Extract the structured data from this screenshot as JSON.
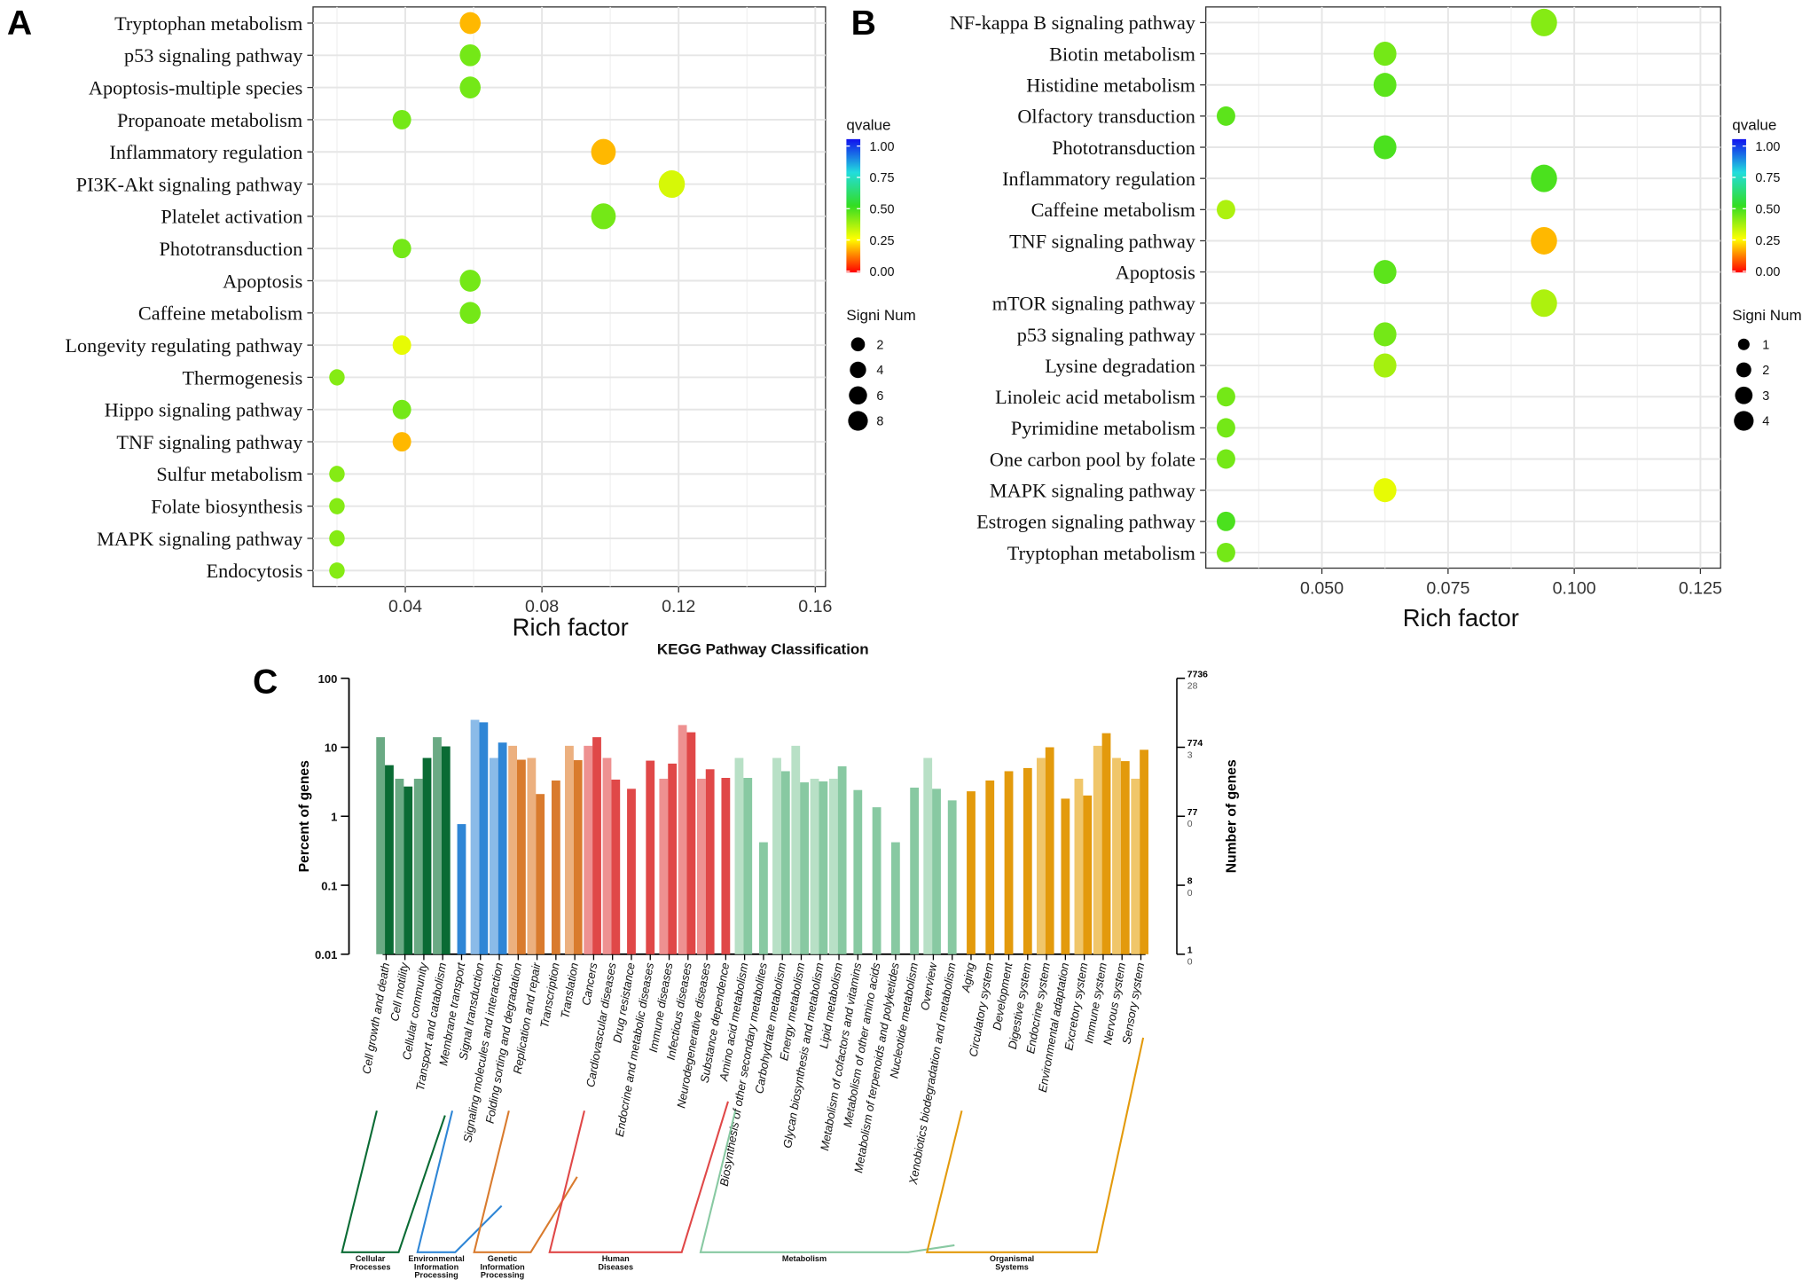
{
  "panels": {
    "a": "A",
    "b": "B",
    "c": "C"
  },
  "chart_data": [
    {
      "id": "panel-a",
      "type": "scatter",
      "title": "",
      "xlabel": "Rich factor",
      "ylabel": "",
      "xlim": [
        0.013,
        0.163
      ],
      "xticks": [
        0.04,
        0.08,
        0.12,
        0.16
      ],
      "xtick_labels": [
        "0.04",
        "0.08",
        "0.12",
        "0.16"
      ],
      "grid": true,
      "legend": {
        "placement": "right",
        "color_title": "qvalue",
        "color_ticks": [
          "1.00",
          "0.75",
          "0.50",
          "0.25",
          "0.00"
        ],
        "size_title": "Signi Num",
        "size_values": [
          2,
          4,
          6,
          8
        ]
      },
      "points": [
        {
          "pathway": "Tryptophan metabolism",
          "rich_factor": 0.059,
          "qvalue": 0.18,
          "signi_num": 3
        },
        {
          "pathway": "p53 signaling pathway",
          "rich_factor": 0.059,
          "qvalue": 0.42,
          "signi_num": 3
        },
        {
          "pathway": "Apoptosis-multiple species",
          "rich_factor": 0.059,
          "qvalue": 0.42,
          "signi_num": 3
        },
        {
          "pathway": "Propanoate metabolism",
          "rich_factor": 0.039,
          "qvalue": 0.42,
          "signi_num": 2
        },
        {
          "pathway": "Inflammatory regulation",
          "rich_factor": 0.098,
          "qvalue": 0.18,
          "signi_num": 5
        },
        {
          "pathway": "PI3K-Akt signaling pathway",
          "rich_factor": 0.118,
          "qvalue": 0.3,
          "signi_num": 6
        },
        {
          "pathway": "Platelet activation",
          "rich_factor": 0.098,
          "qvalue": 0.42,
          "signi_num": 5
        },
        {
          "pathway": "Phototransduction",
          "rich_factor": 0.039,
          "qvalue": 0.42,
          "signi_num": 2
        },
        {
          "pathway": "Apoptosis",
          "rich_factor": 0.059,
          "qvalue": 0.42,
          "signi_num": 3
        },
        {
          "pathway": "Caffeine metabolism",
          "rich_factor": 0.059,
          "qvalue": 0.42,
          "signi_num": 3
        },
        {
          "pathway": "Longevity regulating pathway",
          "rich_factor": 0.039,
          "qvalue": 0.28,
          "signi_num": 2
        },
        {
          "pathway": "Thermogenesis",
          "rich_factor": 0.02,
          "qvalue": 0.4,
          "signi_num": 1
        },
        {
          "pathway": "Hippo signaling pathway",
          "rich_factor": 0.039,
          "qvalue": 0.42,
          "signi_num": 2
        },
        {
          "pathway": "TNF signaling pathway",
          "rich_factor": 0.039,
          "qvalue": 0.18,
          "signi_num": 2
        },
        {
          "pathway": "Sulfur metabolism",
          "rich_factor": 0.02,
          "qvalue": 0.4,
          "signi_num": 1
        },
        {
          "pathway": "Folate biosynthesis",
          "rich_factor": 0.02,
          "qvalue": 0.4,
          "signi_num": 1
        },
        {
          "pathway": "MAPK signaling pathway",
          "rich_factor": 0.02,
          "qvalue": 0.4,
          "signi_num": 1
        },
        {
          "pathway": "Endocytosis",
          "rich_factor": 0.02,
          "qvalue": 0.4,
          "signi_num": 1
        }
      ]
    },
    {
      "id": "panel-b",
      "type": "scatter",
      "title": "",
      "xlabel": "Rich factor",
      "ylabel": "",
      "xlim": [
        0.027,
        0.129
      ],
      "xticks": [
        0.05,
        0.075,
        0.1,
        0.125
      ],
      "xtick_labels": [
        "0.050",
        "0.075",
        "0.100",
        "0.125"
      ],
      "grid": true,
      "legend": {
        "placement": "right",
        "color_title": "qvalue",
        "color_ticks": [
          "1.00",
          "0.75",
          "0.50",
          "0.25",
          "0.00"
        ],
        "size_title": "Signi Num",
        "size_values": [
          1,
          2,
          3,
          4
        ]
      },
      "points": [
        {
          "pathway": "NF-kappa B signaling pathway",
          "rich_factor": 0.094,
          "qvalue": 0.4,
          "signi_num": 3
        },
        {
          "pathway": "Biotin metabolism",
          "rich_factor": 0.0625,
          "qvalue": 0.42,
          "signi_num": 2
        },
        {
          "pathway": "Histidine metabolism",
          "rich_factor": 0.0625,
          "qvalue": 0.45,
          "signi_num": 2
        },
        {
          "pathway": "Olfactory transduction",
          "rich_factor": 0.031,
          "qvalue": 0.45,
          "signi_num": 1
        },
        {
          "pathway": "Phototransduction",
          "rich_factor": 0.0625,
          "qvalue": 0.47,
          "signi_num": 2
        },
        {
          "pathway": "Inflammatory regulation",
          "rich_factor": 0.094,
          "qvalue": 0.47,
          "signi_num": 3
        },
        {
          "pathway": "Caffeine metabolism",
          "rich_factor": 0.031,
          "qvalue": 0.35,
          "signi_num": 1
        },
        {
          "pathway": "TNF signaling pathway",
          "rich_factor": 0.094,
          "qvalue": 0.18,
          "signi_num": 3
        },
        {
          "pathway": "Apoptosis",
          "rich_factor": 0.0625,
          "qvalue": 0.45,
          "signi_num": 2
        },
        {
          "pathway": "mTOR signaling pathway",
          "rich_factor": 0.094,
          "qvalue": 0.35,
          "signi_num": 3
        },
        {
          "pathway": "p53 signaling pathway",
          "rich_factor": 0.0625,
          "qvalue": 0.42,
          "signi_num": 2
        },
        {
          "pathway": "Lysine degradation",
          "rich_factor": 0.0625,
          "qvalue": 0.36,
          "signi_num": 2
        },
        {
          "pathway": "Linoleic acid metabolism",
          "rich_factor": 0.031,
          "qvalue": 0.42,
          "signi_num": 1
        },
        {
          "pathway": "Pyrimidine metabolism",
          "rich_factor": 0.031,
          "qvalue": 0.42,
          "signi_num": 1
        },
        {
          "pathway": "One carbon pool by folate",
          "rich_factor": 0.031,
          "qvalue": 0.42,
          "signi_num": 1
        },
        {
          "pathway": "MAPK signaling pathway",
          "rich_factor": 0.0625,
          "qvalue": 0.28,
          "signi_num": 2
        },
        {
          "pathway": "Estrogen signaling pathway",
          "rich_factor": 0.031,
          "qvalue": 0.47,
          "signi_num": 1
        },
        {
          "pathway": "Tryptophan metabolism",
          "rich_factor": 0.031,
          "qvalue": 0.42,
          "signi_num": 1
        }
      ]
    },
    {
      "id": "panel-c",
      "type": "bar",
      "title": "KEGG Pathway Classification",
      "ylabel": "Percent of genes",
      "y2label": "Number of genes",
      "yscale": "log",
      "ylim": [
        0.01,
        100
      ],
      "yticks": [
        "100",
        "10",
        "1",
        "0.1",
        "0.01"
      ],
      "y2ticks": [
        [
          "7736",
          "28"
        ],
        [
          "774",
          "3"
        ],
        [
          "77",
          "0"
        ],
        [
          "8",
          "0"
        ],
        [
          "1",
          "0"
        ]
      ],
      "series_names": [
        "light",
        "dark"
      ],
      "groups": [
        {
          "name": "Cellular Processes",
          "label_lines": [
            "Cellular",
            "Processes"
          ],
          "dark": "#0a6b34",
          "light": "#6aaa84"
        },
        {
          "name": "Environmental Information Processing",
          "label_lines": [
            "Environmental",
            "Information",
            "Processing"
          ],
          "dark": "#2f86d6",
          "light": "#8bbbe8"
        },
        {
          "name": "Genetic Information Processing",
          "label_lines": [
            "Genetic",
            "Information",
            "Processing"
          ],
          "dark": "#d97b2e",
          "light": "#ecb07f"
        },
        {
          "name": "Human Diseases",
          "label_lines": [
            "Human",
            "Diseases"
          ],
          "dark": "#e04848",
          "light": "#ee9191"
        },
        {
          "name": "Metabolism",
          "label_lines": [
            "Metabolism"
          ],
          "dark": "#88c9a2",
          "light": "#b8e0c6"
        },
        {
          "name": "Organismal Systems",
          "label_lines": [
            "Organismal",
            "Systems"
          ],
          "dark": "#e39a0c",
          "light": "#f0c66a"
        }
      ],
      "categories": [
        {
          "name": "Cell growth and death",
          "group": 0,
          "light": 14,
          "dark": 5.5
        },
        {
          "name": "Cell motility",
          "group": 0,
          "light": 3.5,
          "dark": 2.7
        },
        {
          "name": "Cellular community",
          "group": 0,
          "light": 3.5,
          "dark": 7
        },
        {
          "name": "Transport and catabolism",
          "group": 0,
          "light": 14,
          "dark": 10.3
        },
        {
          "name": "Membrane transport",
          "group": 1,
          "light": null,
          "dark": 0.77
        },
        {
          "name": "Signal transduction",
          "group": 1,
          "light": 25,
          "dark": 23
        },
        {
          "name": "Signaling molecules and interaction",
          "group": 1,
          "light": 7,
          "dark": 11.7
        },
        {
          "name": "Folding sorting and degradation",
          "group": 2,
          "light": 10.5,
          "dark": 6.6
        },
        {
          "name": "Replication and repair",
          "group": 2,
          "light": 7,
          "dark": 2.1
        },
        {
          "name": "Transcription",
          "group": 2,
          "light": null,
          "dark": 3.3
        },
        {
          "name": "Translation",
          "group": 2,
          "light": 10.5,
          "dark": 6.5
        },
        {
          "name": "Cancers",
          "group": 3,
          "light": 10.5,
          "dark": 14
        },
        {
          "name": "Cardiovascular diseases",
          "group": 3,
          "light": 7,
          "dark": 3.4
        },
        {
          "name": "Drug resistance",
          "group": 3,
          "light": null,
          "dark": 2.5
        },
        {
          "name": "Endocrine and metabolic diseases",
          "group": 3,
          "light": null,
          "dark": 6.4
        },
        {
          "name": "Immune diseases",
          "group": 3,
          "light": 3.5,
          "dark": 5.8
        },
        {
          "name": "Infectious diseases",
          "group": 3,
          "light": 21,
          "dark": 16.5
        },
        {
          "name": "Neurodegenerative diseases",
          "group": 3,
          "light": 3.5,
          "dark": 4.8
        },
        {
          "name": "Substance dependence",
          "group": 3,
          "light": null,
          "dark": 3.6
        },
        {
          "name": "Amino acid metabolism",
          "group": 4,
          "light": 7,
          "dark": 3.6
        },
        {
          "name": "Biosynthesis of other secondary metabolites",
          "group": 4,
          "light": null,
          "dark": 0.42
        },
        {
          "name": "Carbohydrate metabolism",
          "group": 4,
          "light": 7,
          "dark": 4.5
        },
        {
          "name": "Energy metabolism",
          "group": 4,
          "light": 10.5,
          "dark": 3.1
        },
        {
          "name": "Glycan biosynthesis and metabolism",
          "group": 4,
          "light": 3.5,
          "dark": 3.2
        },
        {
          "name": "Lipid metabolism",
          "group": 4,
          "light": 3.5,
          "dark": 5.3
        },
        {
          "name": "Metabolism of cofactors and vitamins",
          "group": 4,
          "light": null,
          "dark": 2.4
        },
        {
          "name": "Metabolism of other amino acids",
          "group": 4,
          "light": null,
          "dark": 1.35
        },
        {
          "name": "Metabolism of terpenoids and polyketides",
          "group": 4,
          "light": null,
          "dark": 0.42
        },
        {
          "name": "Nucleotide metabolism",
          "group": 4,
          "light": null,
          "dark": 2.6
        },
        {
          "name": "Overview",
          "group": 4,
          "light": 7,
          "dark": 2.5
        },
        {
          "name": "Xenobiotics biodegradation and metabolism",
          "group": 4,
          "light": null,
          "dark": 1.7
        },
        {
          "name": "Aging",
          "group": 5,
          "light": null,
          "dark": 2.3
        },
        {
          "name": "Circulatory system",
          "group": 5,
          "light": null,
          "dark": 3.3
        },
        {
          "name": "Development",
          "group": 5,
          "light": null,
          "dark": 4.5
        },
        {
          "name": "Digestive system",
          "group": 5,
          "light": null,
          "dark": 5
        },
        {
          "name": "Endocrine system",
          "group": 5,
          "light": 7,
          "dark": 10
        },
        {
          "name": "Environmental adaptation",
          "group": 5,
          "light": null,
          "dark": 1.8
        },
        {
          "name": "Excretory system",
          "group": 5,
          "light": 3.5,
          "dark": 2
        },
        {
          "name": "Immune system",
          "group": 5,
          "light": 10.5,
          "dark": 16
        },
        {
          "name": "Nervous system",
          "group": 5,
          "light": 7,
          "dark": 6.3
        },
        {
          "name": "Sensory system",
          "group": 5,
          "light": 3.5,
          "dark": 9.2
        }
      ]
    }
  ]
}
